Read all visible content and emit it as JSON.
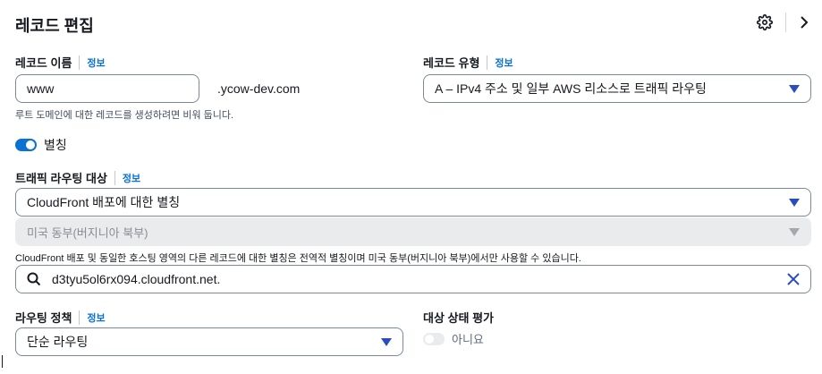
{
  "header": {
    "title": "레코드 편집"
  },
  "record_name": {
    "label": "레코드 이름",
    "info": "정보",
    "value": "www",
    "suffix": ".ycow-dev.com",
    "hint": "루트 도메인에 대한 레코드를 생성하려면 비워 둡니다."
  },
  "record_type": {
    "label": "레코드 유형",
    "info": "정보",
    "value": "A – IPv4 주소 및 일부 AWS 리소스로 트래픽 라우팅"
  },
  "alias": {
    "label": "별칭",
    "enabled": true
  },
  "traffic_target": {
    "label": "트래픽 라우팅 대상",
    "info": "정보",
    "endpoint": "CloudFront 배포에 대한 별칭",
    "region": "미국 동부(버지니아 북부)",
    "hint": "CloudFront 배포 및 동일한 호스팅 영역의 다른 레코드에 대한 별칭은 전역적 별칭이며 미국 동부(버지니아 북부)에서만 사용할 수 있습니다.",
    "search_value": "d3tyu5ol6rx094.cloudfront.net."
  },
  "routing_policy": {
    "label": "라우팅 정책",
    "info": "정보",
    "value": "단순 라우팅"
  },
  "health_eval": {
    "label": "대상 상태 평가",
    "value_label": "아니요",
    "enabled": false
  },
  "colors": {
    "accent": "#0972d3",
    "caret": "#2a4dbd",
    "text": "#16191f"
  }
}
